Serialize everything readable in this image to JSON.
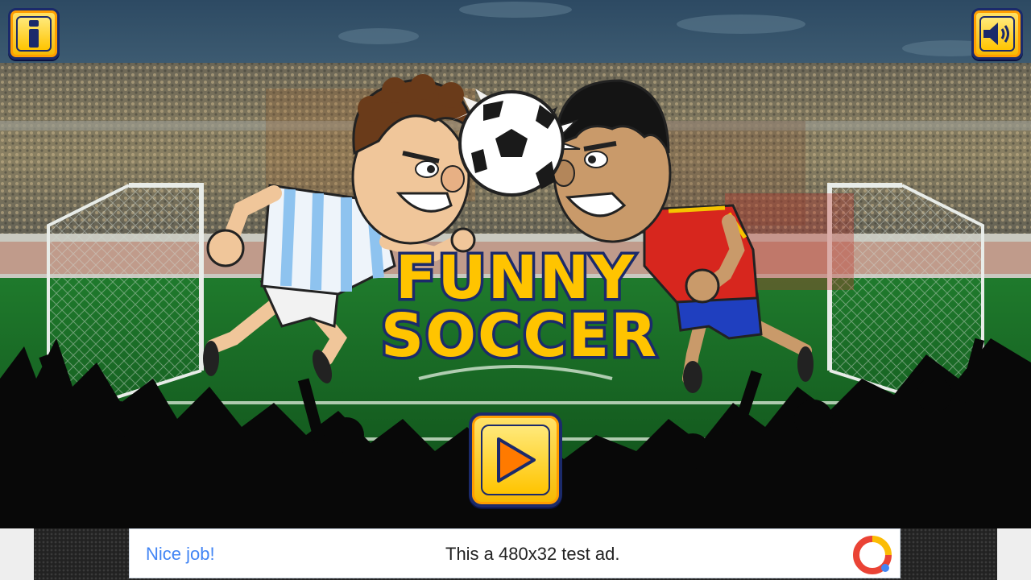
{
  "game": {
    "title_line1": "FUNNY",
    "title_line2": "SOCCER"
  },
  "controls": {
    "info_icon": "info-icon",
    "sound_icon": "speaker-icon",
    "play_icon": "play-icon"
  },
  "ad": {
    "headline": "Nice job!",
    "text": "This a 480x32 test ad."
  },
  "colors": {
    "title_fill": "#ffc400",
    "title_stroke": "#1b2a6b",
    "button_accent": "#ff9d00",
    "pitch_green": "#1f8a2c",
    "ad_headline": "#4285f4"
  }
}
